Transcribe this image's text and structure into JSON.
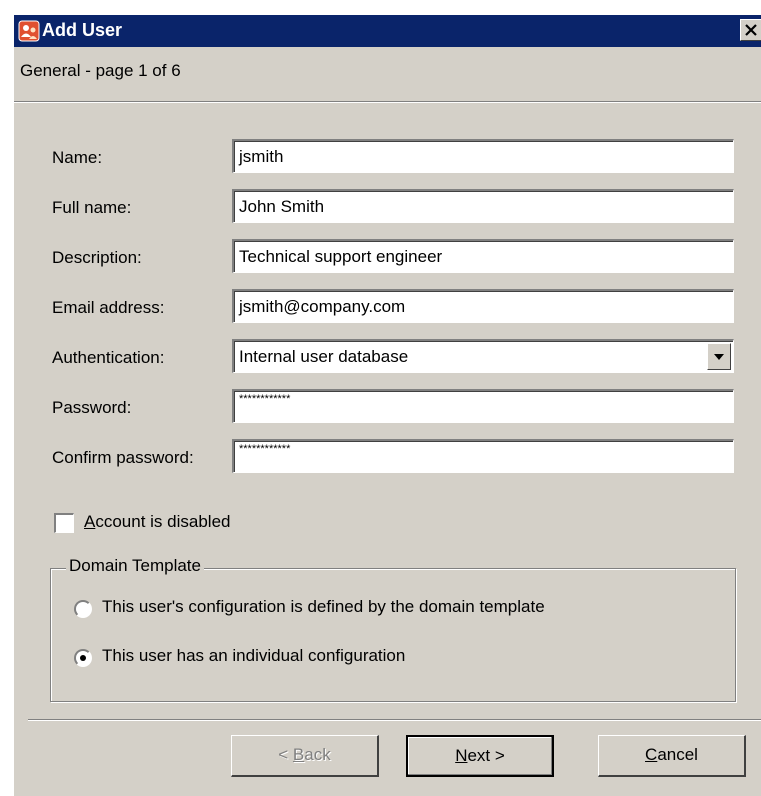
{
  "window": {
    "title": "Add User",
    "icon": "user-app-icon",
    "close_label": "×"
  },
  "page_header": "General - page 1 of 6",
  "form": {
    "name": {
      "label": "Name:",
      "value": "jsmith"
    },
    "full_name": {
      "label": "Full name:",
      "value": "John Smith"
    },
    "description": {
      "label": "Description:",
      "value": "Technical support engineer"
    },
    "email": {
      "label": "Email address:",
      "value": "jsmith@company.com"
    },
    "authentication": {
      "label": "Authentication:",
      "value": "Internal user database"
    },
    "password": {
      "label": "Password:",
      "value": "************"
    },
    "confirm_password": {
      "label": "Confirm  password:",
      "value": "************"
    }
  },
  "account_disabled": {
    "label_underlined": "A",
    "label_rest": "ccount is disabled",
    "checked": false
  },
  "domain_template": {
    "legend": "Domain Template",
    "options": [
      {
        "label": "This user's configuration is defined by the domain template",
        "selected": false
      },
      {
        "label": "This user has an individual configuration",
        "selected": true
      }
    ]
  },
  "buttons": {
    "back": {
      "prefix": "< ",
      "underlined": "B",
      "rest": "ack",
      "enabled": false
    },
    "next": {
      "underlined": "N",
      "rest": "ext >",
      "enabled": true
    },
    "cancel": {
      "underlined": "C",
      "rest": "ancel",
      "enabled": true
    }
  },
  "colors": {
    "titlebar": "#0a246a",
    "dialog_bg": "#d4d0c8"
  }
}
